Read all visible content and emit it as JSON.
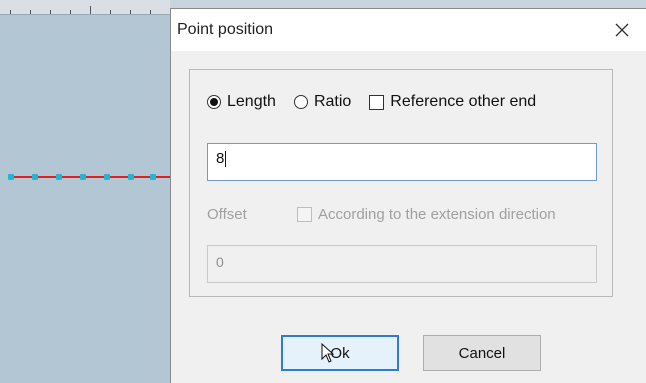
{
  "dialog": {
    "title": "Point position",
    "close_symbol": "×"
  },
  "mode": {
    "options": [
      {
        "label": "Length",
        "selected": true
      },
      {
        "label": "Ratio",
        "selected": false
      }
    ],
    "reference_other_end": {
      "label": "Reference other end",
      "checked": false
    }
  },
  "value_input": {
    "value": "8"
  },
  "offset": {
    "label": "Offset",
    "extension_direction": {
      "label": "According to the extension direction",
      "checked": false,
      "enabled": false
    },
    "value": "0"
  },
  "buttons": {
    "ok_label": "Ok",
    "cancel_label": "Cancel"
  },
  "icons": [
    "close-icon",
    "mouse-cursor-icon"
  ],
  "colors": {
    "focus_border": "#2e7bd6",
    "line": "#e02020",
    "point": "#1fb7d6"
  }
}
